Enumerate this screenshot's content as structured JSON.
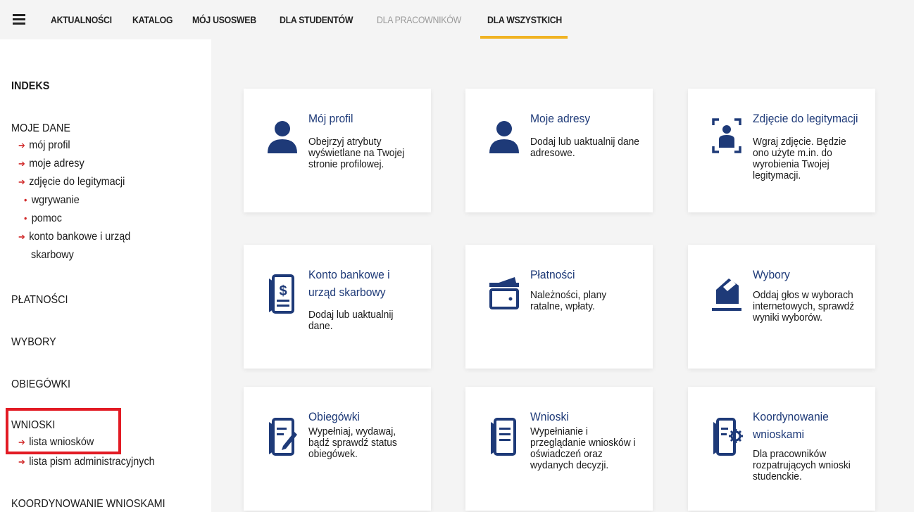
{
  "nav": {
    "items": [
      {
        "label": "AKTUALNOŚCI"
      },
      {
        "label": "KATALOG"
      },
      {
        "label": "MÓJ USOSWEB"
      },
      {
        "label": "DLA STUDENTÓW"
      },
      {
        "label": "DLA PRACOWNIKÓW"
      },
      {
        "label": "DLA WSZYSTKICH"
      }
    ],
    "active": "DLA WSZYSTKICH",
    "accent_color": "#f0b323"
  },
  "sidebar": {
    "indeks": "INDEKS",
    "moje_dane": "MOJE DANE",
    "moje_dane_items": [
      "mój profil",
      "moje adresy",
      "zdjęcie do legitymacji"
    ],
    "zdjecie_sub": [
      "wgrywanie",
      "pomoc"
    ],
    "konto_line1": "konto bankowe i urząd",
    "konto_line2": "skarbowy",
    "platnosci": "PŁATNOŚCI",
    "wybory": "WYBORY",
    "obiegowki": "OBIEGÓWKI",
    "wnioski": "WNIOSKI",
    "wnioski_items": [
      "lista wniosków",
      "lista pism administracyjnych"
    ],
    "koordynowanie": "KOORDYNOWANIE WNIOSKAMI",
    "highlight_color": "#e21b24"
  },
  "cards": [
    {
      "title": "Mój profil",
      "desc": "Obejrzyj atrybuty wyświetlane na Twojej stronie profilowej.",
      "icon": "person-icon"
    },
    {
      "title": "Moje adresy",
      "desc": "Dodaj lub uaktualnij dane adresowe.",
      "icon": "person-icon"
    },
    {
      "title": "Zdjęcie do legitymacji",
      "desc": "Wgraj zdjęcie. Będzie ono użyte m.in. do wyrobienia Twojej legitymacji.",
      "icon": "photo-id-icon"
    },
    {
      "title": "Konto bankowe i urząd skarbowy",
      "desc": "Dodaj lub uaktualnij dane.",
      "icon": "bank-document-icon"
    },
    {
      "title": "Płatności",
      "desc": "Należności, plany ratalne, wpłaty.",
      "icon": "wallet-icon"
    },
    {
      "title": "Wybory",
      "desc": "Oddaj głos w wyborach internetowych, sprawdź wyniki wyborów.",
      "icon": "ballot-icon"
    },
    {
      "title": "Obiegówki",
      "desc": "Wypełniaj, wydawaj, bądź sprawdź status obiegówek.",
      "icon": "edit-document-icon"
    },
    {
      "title": "Wnioski",
      "desc": "Wypełnianie i przeglądanie wniosków i oświadczeń oraz wydanych decyzji.",
      "icon": "document-list-icon"
    },
    {
      "title": "Koordynowanie wnioskami",
      "desc": "Dla pracowników rozpatrujących wnioski studenckie.",
      "icon": "document-gear-icon"
    }
  ],
  "icon_color": "#1e3a78"
}
